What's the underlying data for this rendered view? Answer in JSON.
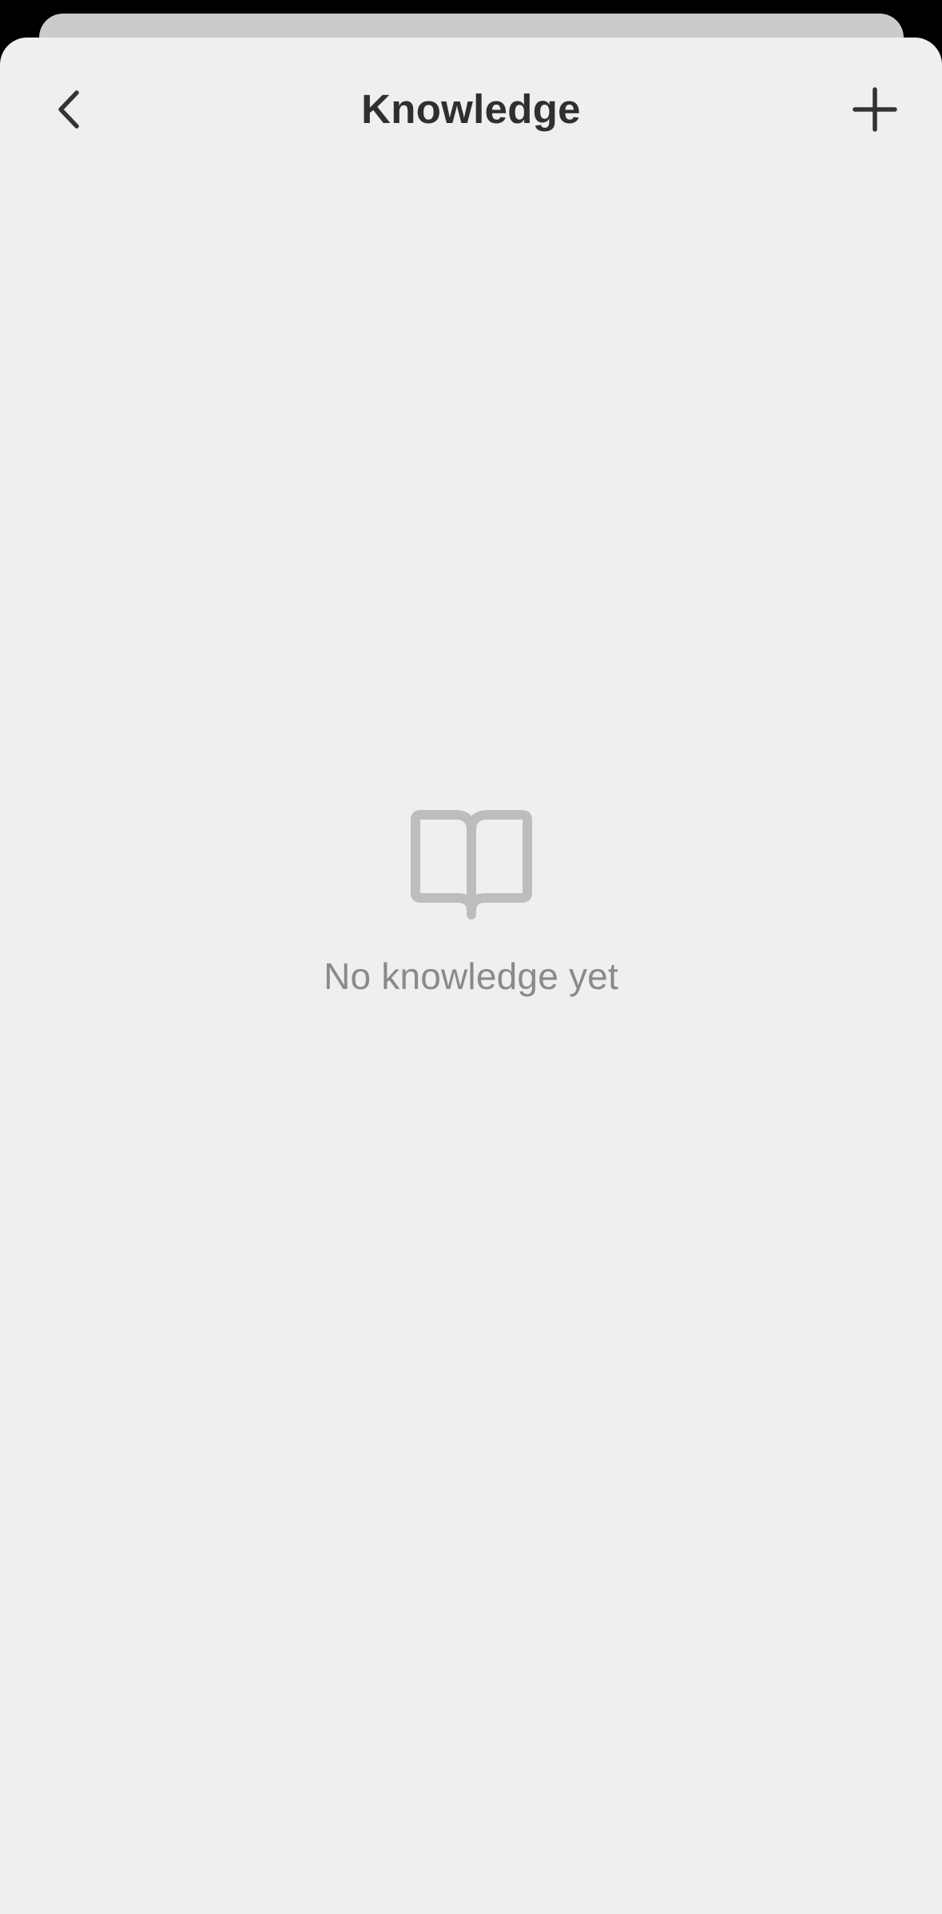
{
  "header": {
    "title": "Knowledge",
    "back_icon": "chevron-left-icon",
    "add_icon": "plus-icon"
  },
  "empty_state": {
    "icon": "open-book-icon",
    "message": "No knowledge yet"
  },
  "colors": {
    "sheet_background": "#efefef",
    "backdrop": "#000000",
    "stacked_card": "#cbcbcb",
    "title_text": "#2f2f2f",
    "icon_dark": "#333333",
    "empty_icon": "#bdbdbb",
    "empty_text": "#8a8a8a"
  }
}
